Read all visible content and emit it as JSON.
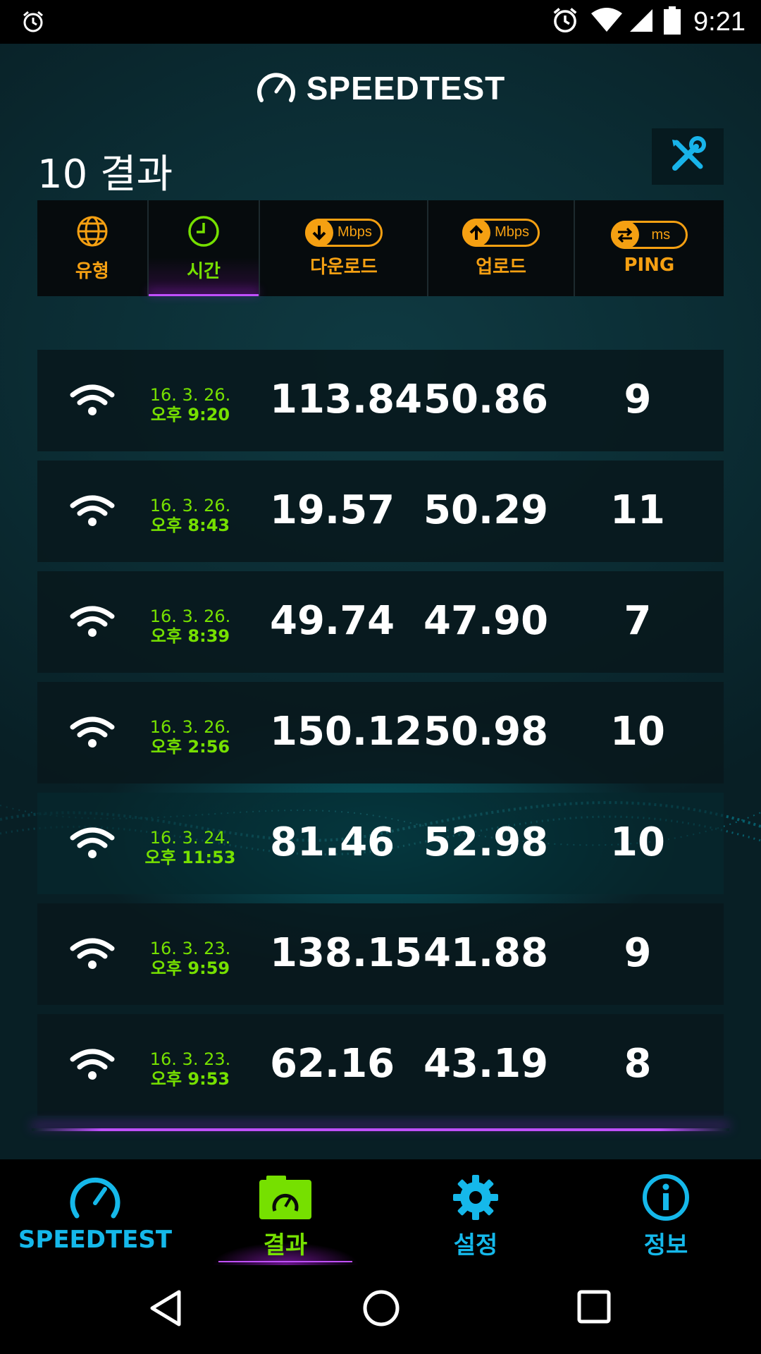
{
  "status_bar": {
    "time": "9:21"
  },
  "app": {
    "logo_text": "SPEEDTEST",
    "results_title": "10 결과"
  },
  "sort_header": {
    "type_label": "유형",
    "time_label": "시간",
    "download_unit": "Mbps",
    "download_label": "다운로드",
    "upload_unit": "Mbps",
    "upload_label": "업로드",
    "ping_unit": "ms",
    "ping_label": "PING",
    "active_column": "시간"
  },
  "results": [
    {
      "date": "16. 3. 26.",
      "time": "오후 9:20",
      "download": "113.84",
      "upload": "50.86",
      "ping": "9"
    },
    {
      "date": "16. 3. 26.",
      "time": "오후 8:43",
      "download": "19.57",
      "upload": "50.29",
      "ping": "11"
    },
    {
      "date": "16. 3. 26.",
      "time": "오후 8:39",
      "download": "49.74",
      "upload": "47.90",
      "ping": "7"
    },
    {
      "date": "16. 3. 26.",
      "time": "오후 2:56",
      "download": "150.12",
      "upload": "50.98",
      "ping": "10"
    },
    {
      "date": "16. 3. 24.",
      "time": "오후 11:53",
      "download": "81.46",
      "upload": "52.98",
      "ping": "10"
    },
    {
      "date": "16. 3. 23.",
      "time": "오후 9:59",
      "download": "138.15",
      "upload": "41.88",
      "ping": "9"
    },
    {
      "date": "16. 3. 23.",
      "time": "오후 9:53",
      "download": "62.16",
      "upload": "43.19",
      "ping": "8"
    }
  ],
  "bottom_nav": {
    "speedtest": "SPEEDTEST",
    "results": "결과",
    "settings": "설정",
    "info": "정보",
    "active": "결과"
  },
  "colors": {
    "accent_orange": "#f5a012",
    "accent_green": "#76e000",
    "accent_blue": "#15b8ea",
    "accent_purple": "#c050ff"
  }
}
